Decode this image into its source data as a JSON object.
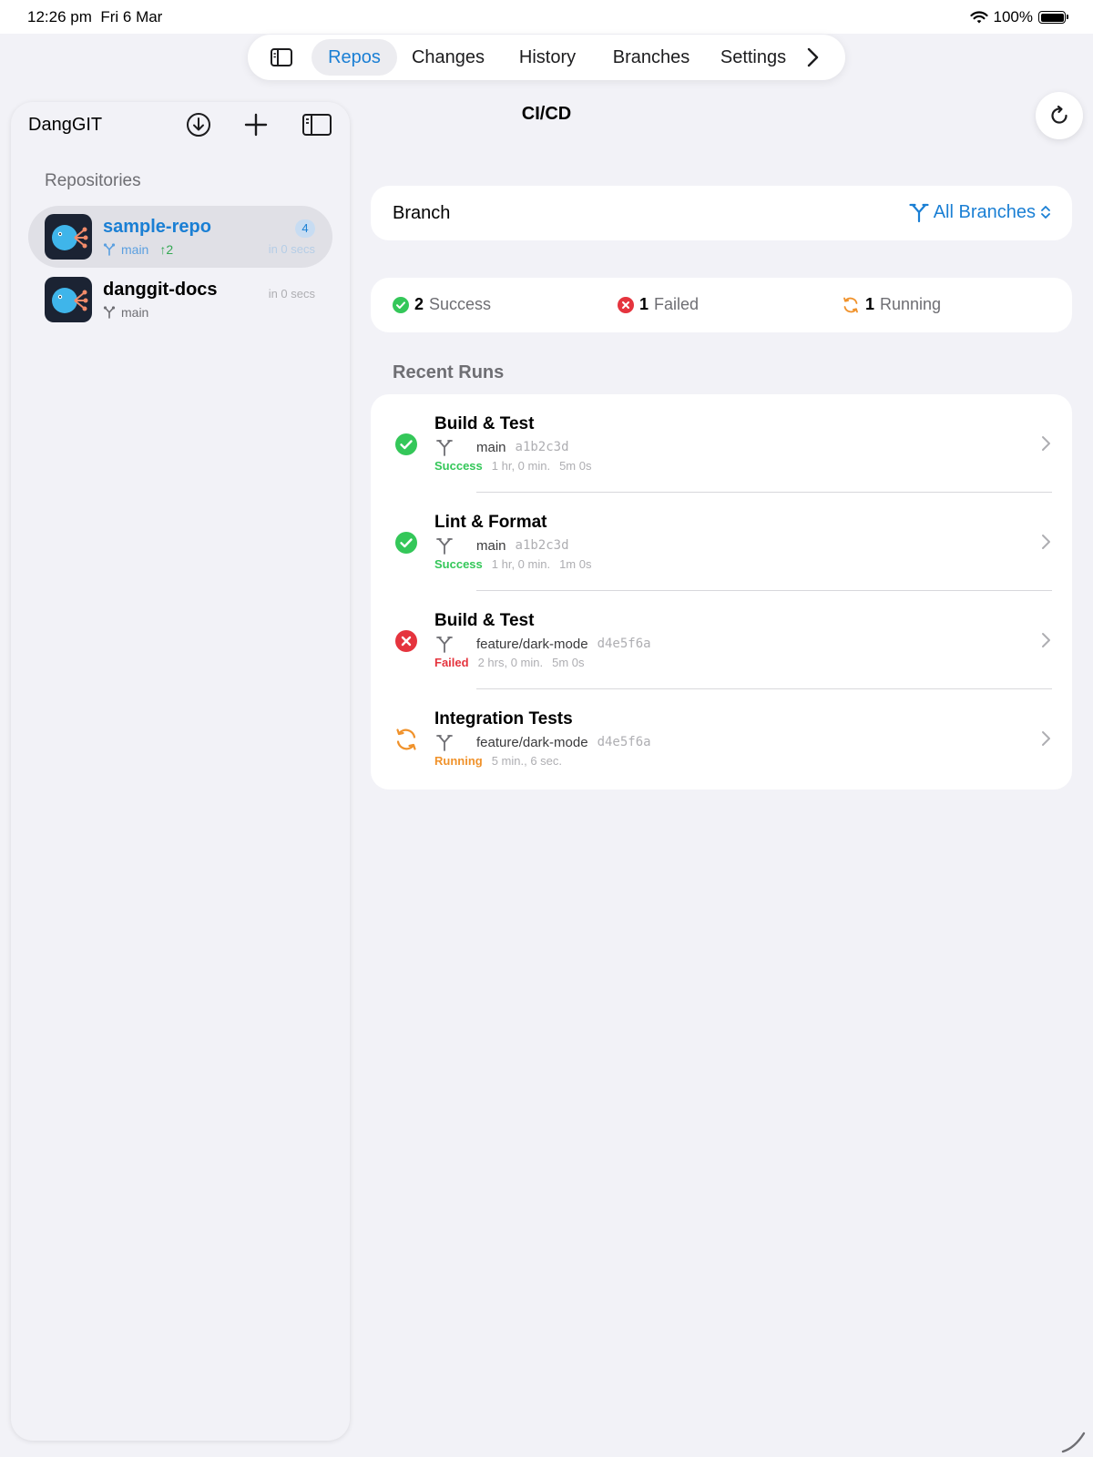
{
  "status_bar": {
    "time": "12:26 pm",
    "date": "Fri 6 Mar",
    "battery": "100%"
  },
  "tabbar": {
    "tabs": [
      {
        "label": "Repos",
        "active": true
      },
      {
        "label": "Changes"
      },
      {
        "label": "History"
      },
      {
        "label": "Branches"
      },
      {
        "label": "Settings"
      }
    ],
    "left_icon": "sidebar-icon",
    "right_icon": "chevron-right-icon"
  },
  "sidebar": {
    "title": "DangGIT",
    "actions": [
      "download-icon",
      "plus-icon",
      "sidebar-icon"
    ],
    "section_label": "Repositories",
    "repos": [
      {
        "name": "sample-repo",
        "branch": "main",
        "ahead": "2",
        "badge": "4",
        "time": "in 0 secs",
        "selected": true
      },
      {
        "name": "danggit-docs",
        "branch": "main",
        "time": "in 0 secs"
      }
    ]
  },
  "main": {
    "title": "CI/CD",
    "branch_label": "Branch",
    "branch_value": "All Branches",
    "summary": [
      {
        "count": "2",
        "label": "Success",
        "status": "success"
      },
      {
        "count": "1",
        "label": "Failed",
        "status": "failed"
      },
      {
        "count": "1",
        "label": "Running",
        "status": "running"
      }
    ],
    "recent_runs_label": "Recent Runs",
    "runs": [
      {
        "name": "Build & Test",
        "branch": "main",
        "sha": "a1b2c3d",
        "status": "Success",
        "ago": "1 hr, 0 min.",
        "duration": "5m 0s"
      },
      {
        "name": "Lint & Format",
        "branch": "main",
        "sha": "a1b2c3d",
        "status": "Success",
        "ago": "1 hr, 0 min.",
        "duration": "1m 0s"
      },
      {
        "name": "Build & Test",
        "branch": "feature/dark-mode",
        "sha": "d4e5f6a",
        "status": "Failed",
        "ago": "2 hrs, 0 min.",
        "duration": "5m 0s"
      },
      {
        "name": "Integration Tests",
        "branch": "feature/dark-mode",
        "sha": "d4e5f6a",
        "status": "Running",
        "ago": "5 min., 6 sec.",
        "duration": ""
      }
    ]
  },
  "colors": {
    "accent": "#1a7fd4",
    "success": "#34c759",
    "failed": "#e5343e",
    "running": "#f0922b",
    "background": "#f2f2f7"
  }
}
